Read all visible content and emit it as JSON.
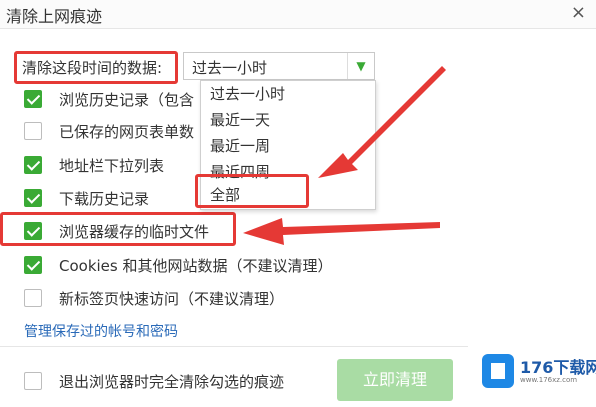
{
  "window": {
    "title": "清除上网痕迹",
    "close_symbol": "×"
  },
  "time_range": {
    "label": "清除这段时间的数据:",
    "selected": "过去一小时",
    "options": [
      "过去一小时",
      "最近一天",
      "最近一周",
      "最近四周",
      "全部"
    ],
    "highlighted_option": "全部"
  },
  "checkboxes": [
    {
      "label": "浏览历史记录（包含",
      "checked": true
    },
    {
      "label": "已保存的网页表单数",
      "checked": false
    },
    {
      "label": "地址栏下拉列表",
      "checked": true
    },
    {
      "label": "下载历史记录",
      "checked": true
    },
    {
      "label": "浏览器缓存的临时文件",
      "checked": true
    },
    {
      "label": "Cookies 和其他网站数据（不建议清理）",
      "checked": true
    },
    {
      "label": "新标签页快速访问（不建议清理）",
      "checked": false
    }
  ],
  "link": {
    "label": "管理保存过的帐号和密码"
  },
  "footer": {
    "checkbox_label": "退出浏览器时完全清除勾选的痕迹",
    "checkbox_checked": false,
    "clear_button": "立即清理"
  },
  "watermark": {
    "logo_icon": "176-download-logo-icon",
    "text": "176下载网",
    "subtext": "www.176xz.com"
  },
  "colors": {
    "accent_green": "#3aaa35",
    "annotation_red": "#e53935",
    "link_blue": "#2a6ab8"
  }
}
